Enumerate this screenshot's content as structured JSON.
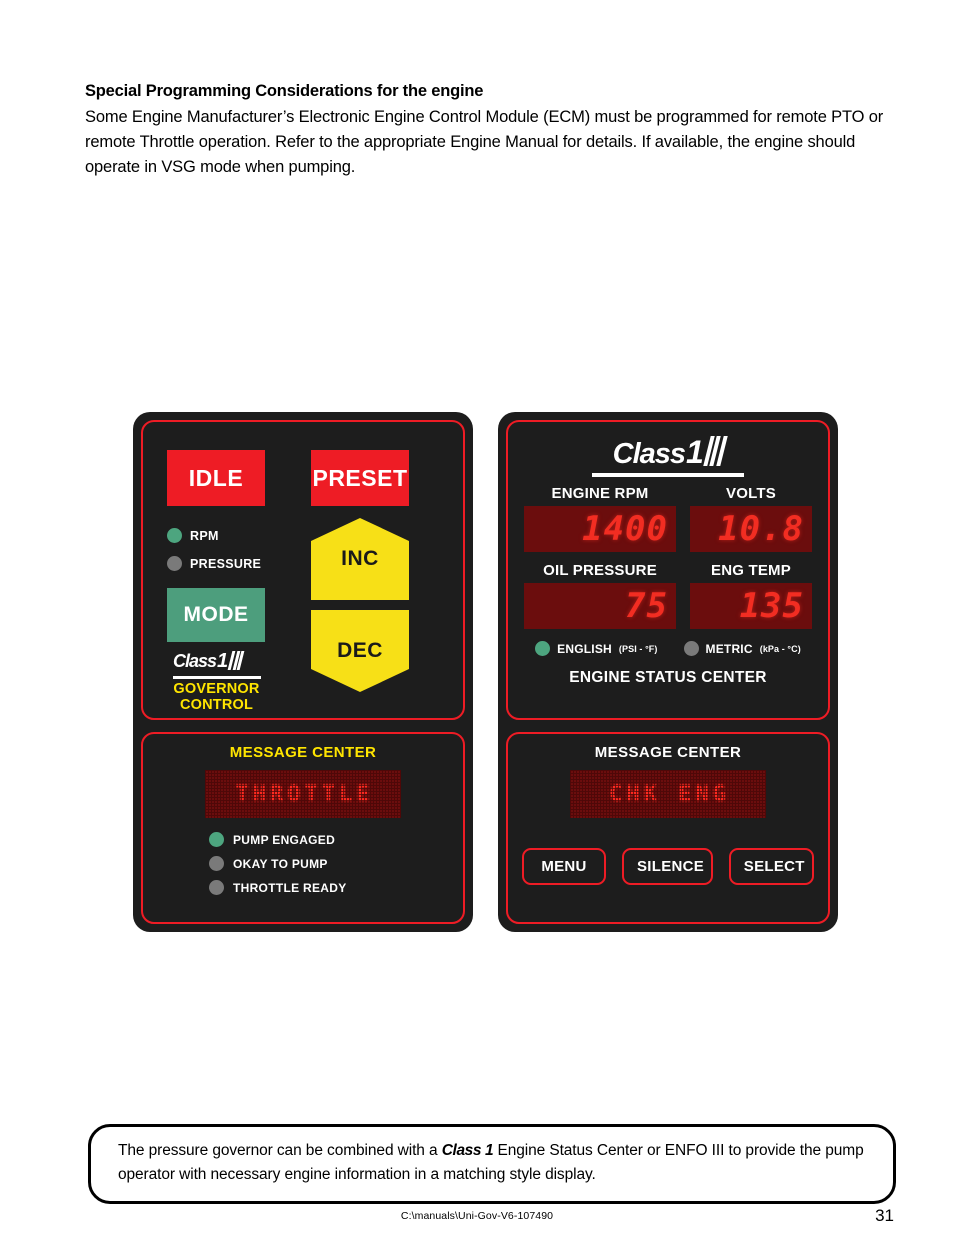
{
  "intro": {
    "heading": "Special Programming Considerations for the engine",
    "body": "Some Engine Manufacturer’s Electronic Engine Control Module (ECM) must be programmed for remote PTO or remote Throttle operation.  Refer to the appropriate Engine Manual for details.  If available, the engine should operate in VSG mode when pumping."
  },
  "colors": {
    "bezel": "#1d1d1d",
    "outline_red": "#ee1c25",
    "button_red": "#ee1c25",
    "button_yellow": "#f7e017",
    "button_green": "#4d9e7d",
    "led_on_green": "#4da57f",
    "led_off_gray": "#7a7a7a",
    "caption_yellow": "#ffe500",
    "led_display_bg": "#6b0d0d",
    "led_digit_red": "#f22d22"
  },
  "governor_panel": {
    "idle_label": "IDLE",
    "preset_label": "PRESET",
    "mode_label": "MODE",
    "inc_label": "INC",
    "dec_label": "DEC",
    "indicators": [
      {
        "label": "RPM",
        "state": "on"
      },
      {
        "label": "PRESSURE",
        "state": "off"
      }
    ],
    "logo": {
      "text": "Class",
      "numeral": "1"
    },
    "caption_line1": "GOVERNOR",
    "caption_line2": "CONTROL"
  },
  "governor_message_center": {
    "title": "MESSAGE CENTER",
    "display_text": "THROTTLE",
    "indicators": [
      {
        "label": "PUMP ENGAGED",
        "state": "on"
      },
      {
        "label": "OKAY TO PUMP",
        "state": "off"
      },
      {
        "label": "THROTTLE READY",
        "state": "off"
      }
    ]
  },
  "engine_status_center": {
    "logo": {
      "text": "Class",
      "numeral": "1"
    },
    "gauges": [
      {
        "label": "ENGINE RPM",
        "value": "1400"
      },
      {
        "label": "VOLTS",
        "value": "10.8"
      },
      {
        "label": "OIL PRESSURE",
        "value": "75"
      },
      {
        "label": "ENG TEMP",
        "value": "135"
      }
    ],
    "units": [
      {
        "name": "ENGLISH",
        "sub": "(PSI - °F)",
        "state": "on"
      },
      {
        "name": "METRIC",
        "sub": "(kPa - °C)",
        "state": "off"
      }
    ],
    "caption": "ENGINE STATUS CENTER"
  },
  "engine_message_center": {
    "title": "MESSAGE CENTER",
    "display_text": "CHK ENG",
    "buttons": [
      "MENU",
      "SILENCE",
      "SELECT"
    ]
  },
  "callout": {
    "text_before": "The pressure governor can be combined with a ",
    "brand": "Class 1",
    "text_after": " Engine Status Center or ENFO III to provide the pump operator with necessary engine information in a matching style display."
  },
  "footer": {
    "path": "C:\\manuals\\Uni-Gov-V6-107490",
    "page_number": "31"
  }
}
